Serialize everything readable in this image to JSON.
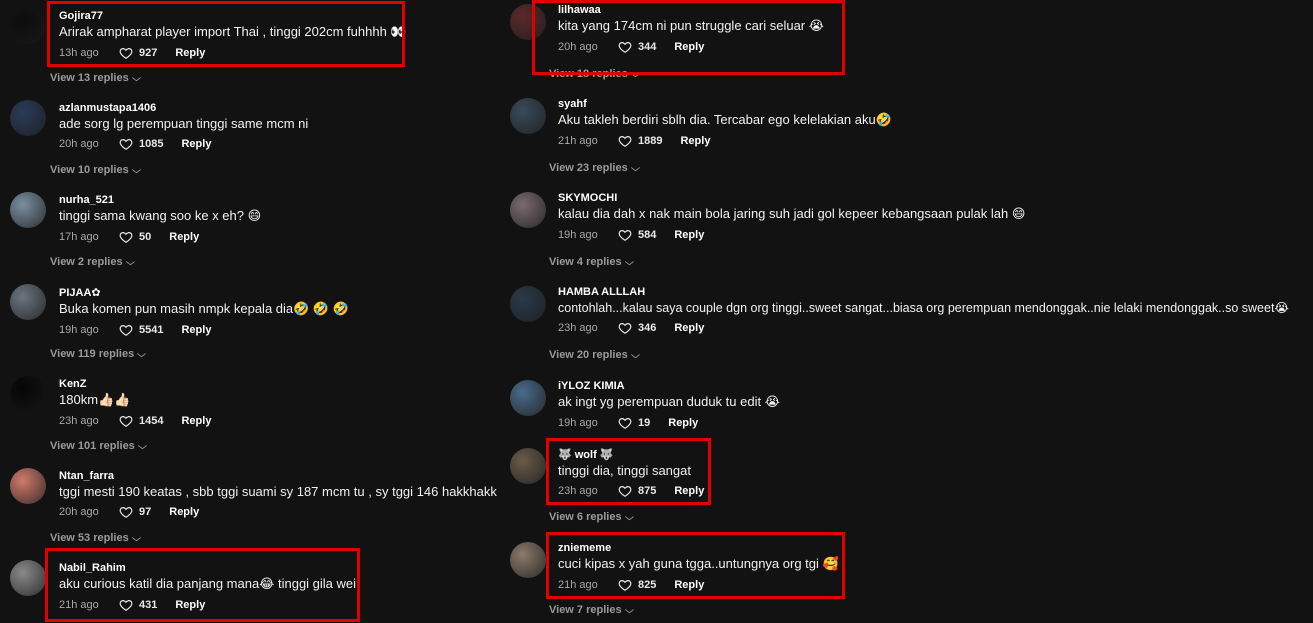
{
  "colors": {
    "background": "#121212",
    "highlight": "#e00000",
    "muted_text": "#a8a8a8"
  },
  "left": [
    {
      "user": "Gojira77",
      "text": "Arirak ampharat player import Thai , tinggi 202cm fuhhhh 👀",
      "time": "13h ago",
      "likes": "927",
      "reply": "Reply",
      "view": "View 13 replies",
      "avatar": "#0c0c0c"
    },
    {
      "user": "azlanmustapa1406",
      "text": "ade sorg lg perempuan tinggi same mcm ni",
      "time": "20h ago",
      "likes": "1085",
      "reply": "Reply",
      "view": "View 10 replies",
      "avatar": "#2a3b59"
    },
    {
      "user": "nurha_521",
      "text": "tinggi sama kwang soo ke x eh? 😄",
      "time": "17h ago",
      "likes": "50",
      "reply": "Reply",
      "view": "View 2 replies",
      "avatar": "#7b8fa0"
    },
    {
      "user": "PIJAA✿",
      "text": "Buka komen pun masih nmpk kepala dia🤣 🤣 🤣",
      "time": "19h ago",
      "likes": "5541",
      "reply": "Reply",
      "view": "View 119 replies",
      "avatar": "#6a7580"
    },
    {
      "user": "KenZ",
      "text": "180km👍🏻👍🏻",
      "time": "23h ago",
      "likes": "1454",
      "reply": "Reply",
      "view": "View 101 replies",
      "avatar": "#050505"
    },
    {
      "user": "Ntan_farra",
      "text": "tggi mesti 190 keatas , sbb tggi suami sy 187 mcm tu , sy tggi 146 hakkhakk",
      "time": "20h ago",
      "likes": "97",
      "reply": "Reply",
      "view": "View 53 replies",
      "avatar": "#d07a6a"
    },
    {
      "user": "Nabil_Rahim",
      "text": "aku curious katil dia panjang mana😂  tinggi gila wei",
      "time": "21h ago",
      "likes": "431",
      "reply": "Reply",
      "view": "",
      "avatar": "#8a8a8a"
    }
  ],
  "right": [
    {
      "user": "lilhawaa",
      "text": "kita yang 174cm ni pun struggle cari seluar 😭",
      "time": "20h ago",
      "likes": "344",
      "reply": "Reply",
      "view": "View 18 replies",
      "avatar": "#5a2a2a"
    },
    {
      "user": "syahf",
      "text": "Aku takleh berdiri sblh dia. Tercabar ego kelelakian aku🤣",
      "time": "21h ago",
      "likes": "1889",
      "reply": "Reply",
      "view": "View 23 replies",
      "avatar": "#3a4a5a"
    },
    {
      "user": "SKYMOCHI",
      "text": "kalau dia dah x nak main bola jaring suh jadi gol kepeer kebangsaan pulak lah 😄",
      "time": "19h ago",
      "likes": "584",
      "reply": "Reply",
      "view": "View 4 replies",
      "avatar": "#7a6a70"
    },
    {
      "user": "HAMBA ALLLAH",
      "text": "contohlah...kalau saya couple dgn org tinggi..sweet sangat...biasa org perempuan mendonggak..nie lelaki mendonggak..so sweet😭",
      "time": "23h ago",
      "likes": "346",
      "reply": "Reply",
      "view": "View 20 replies",
      "avatar": "#2a3a4a"
    },
    {
      "user": "iYLOZ KIMIA",
      "text": "ak ingt yg perempuan duduk tu edit 😭",
      "time": "19h ago",
      "likes": "19",
      "reply": "Reply",
      "view": "",
      "avatar": "#4a6a8a"
    },
    {
      "user": "🐺 wolf 🐺",
      "text": "tinggi dia, tinggi sangat",
      "time": "23h ago",
      "likes": "875",
      "reply": "Reply",
      "view": "View 6 replies",
      "avatar": "#6a5a4a"
    },
    {
      "user": "zniememe",
      "text": "cuci kipas x yah guna tgga..untungnya org tgi 🥰",
      "time": "21h ago",
      "likes": "825",
      "reply": "Reply",
      "view": "View 7 replies",
      "avatar": "#8a7a6a"
    }
  ]
}
